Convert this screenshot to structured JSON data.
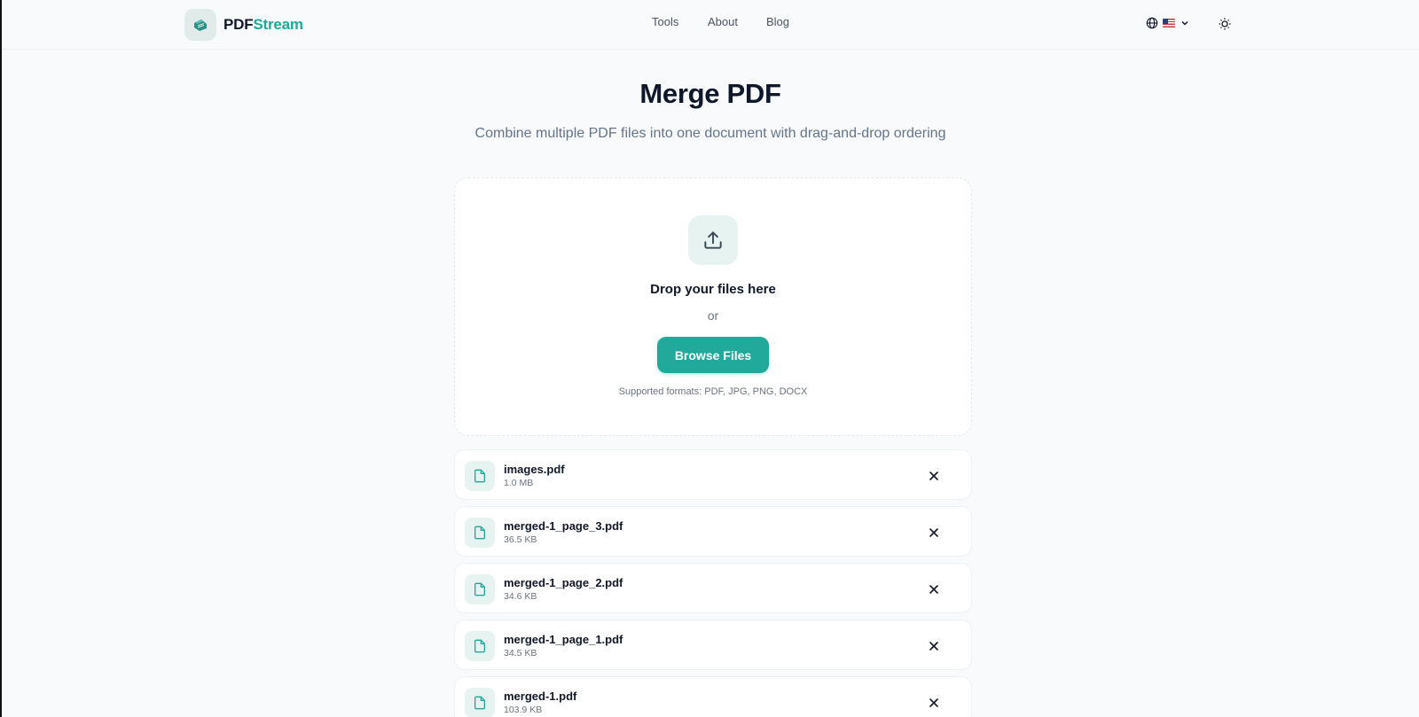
{
  "header": {
    "logo_part_a": "PDF",
    "logo_part_b": "Stream",
    "nav": {
      "tools": "Tools",
      "about": "About",
      "blog": "Blog"
    },
    "language_flag": "us-flag",
    "icons": {
      "globe": "globe-icon",
      "chevron": "chevron-down-icon",
      "theme": "sun-icon"
    }
  },
  "page": {
    "title": "Merge PDF",
    "subtitle": "Combine multiple PDF files into one document with drag-and-drop ordering"
  },
  "dropzone": {
    "title": "Drop your files here",
    "or": "or",
    "browse_label": "Browse Files",
    "formats": "Supported formats: PDF, JPG, PNG, DOCX",
    "icon": "upload-icon"
  },
  "files": [
    {
      "name": "images.pdf",
      "size": "1.0 MB"
    },
    {
      "name": "merged-1_page_3.pdf",
      "size": "36.5 KB"
    },
    {
      "name": "merged-1_page_2.pdf",
      "size": "34.6 KB"
    },
    {
      "name": "merged-1_page_1.pdf",
      "size": "34.5 KB"
    },
    {
      "name": "merged-1.pdf",
      "size": "103.9 KB"
    }
  ],
  "colors": {
    "accent": "#21a99b",
    "accent_light": "#e6f3f1",
    "text_dark": "#0f172a",
    "text_muted": "#64748b"
  }
}
